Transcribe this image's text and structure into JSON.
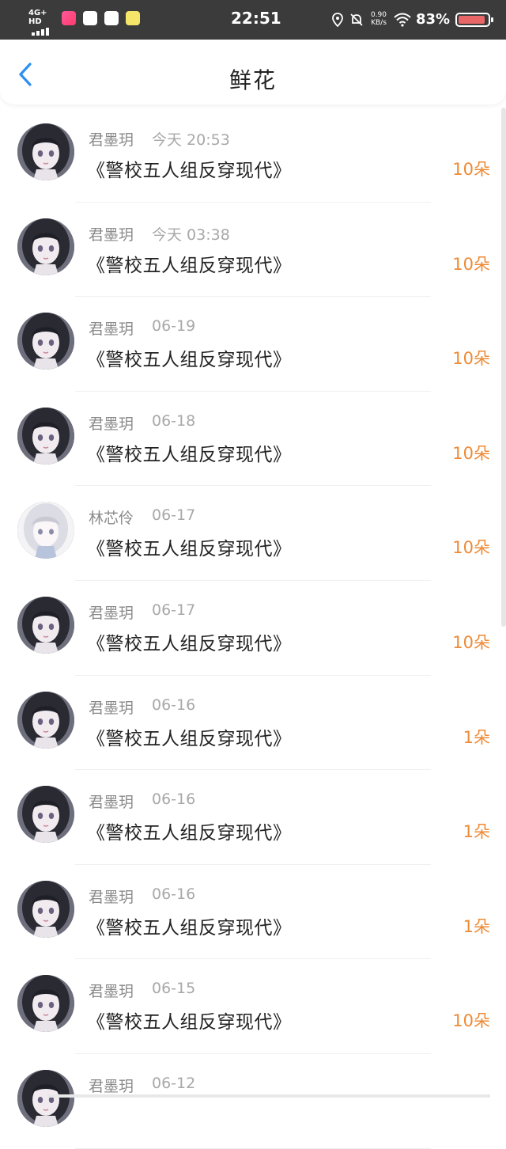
{
  "status_bar": {
    "network": "4G+ HD",
    "time": "22:51",
    "speed_value": "0.90",
    "speed_unit": "KB/s",
    "battery": "83%",
    "icons": [
      "signal-icon",
      "app-icon-1",
      "app-icon-2",
      "app-icon-3",
      "app-icon-4",
      "location-icon",
      "mute-icon",
      "wifi-icon",
      "battery-icon"
    ]
  },
  "header": {
    "title": "鲜花",
    "back_icon": "chevron-left-icon",
    "accent": "#2d8ff0"
  },
  "colors": {
    "amount": "#ee8a35",
    "name": "#8a8a8a",
    "date": "#a8a8a8"
  },
  "items": [
    {
      "name": "君墨玥",
      "date": "今天 20:53",
      "book": "《警校五人组反穿现代》",
      "amount": "10朵",
      "avatar": "dark-hair"
    },
    {
      "name": "君墨玥",
      "date": "今天 03:38",
      "book": "《警校五人组反穿现代》",
      "amount": "10朵",
      "avatar": "dark-hair"
    },
    {
      "name": "君墨玥",
      "date": "06-19",
      "book": "《警校五人组反穿现代》",
      "amount": "10朵",
      "avatar": "dark-hair"
    },
    {
      "name": "君墨玥",
      "date": "06-18",
      "book": "《警校五人组反穿现代》",
      "amount": "10朵",
      "avatar": "dark-hair"
    },
    {
      "name": "林芯伶",
      "date": "06-17",
      "book": "《警校五人组反穿现代》",
      "amount": "10朵",
      "avatar": "light-hair"
    },
    {
      "name": "君墨玥",
      "date": "06-17",
      "book": "《警校五人组反穿现代》",
      "amount": "10朵",
      "avatar": "dark-hair"
    },
    {
      "name": "君墨玥",
      "date": "06-16",
      "book": "《警校五人组反穿现代》",
      "amount": "1朵",
      "avatar": "dark-hair"
    },
    {
      "name": "君墨玥",
      "date": "06-16",
      "book": "《警校五人组反穿现代》",
      "amount": "1朵",
      "avatar": "dark-hair"
    },
    {
      "name": "君墨玥",
      "date": "06-16",
      "book": "《警校五人组反穿现代》",
      "amount": "1朵",
      "avatar": "dark-hair"
    },
    {
      "name": "君墨玥",
      "date": "06-15",
      "book": "《警校五人组反穿现代》",
      "amount": "10朵",
      "avatar": "dark-hair"
    },
    {
      "name": "君墨玥",
      "date": "06-12",
      "book": "",
      "amount": "",
      "avatar": "dark-hair"
    }
  ]
}
